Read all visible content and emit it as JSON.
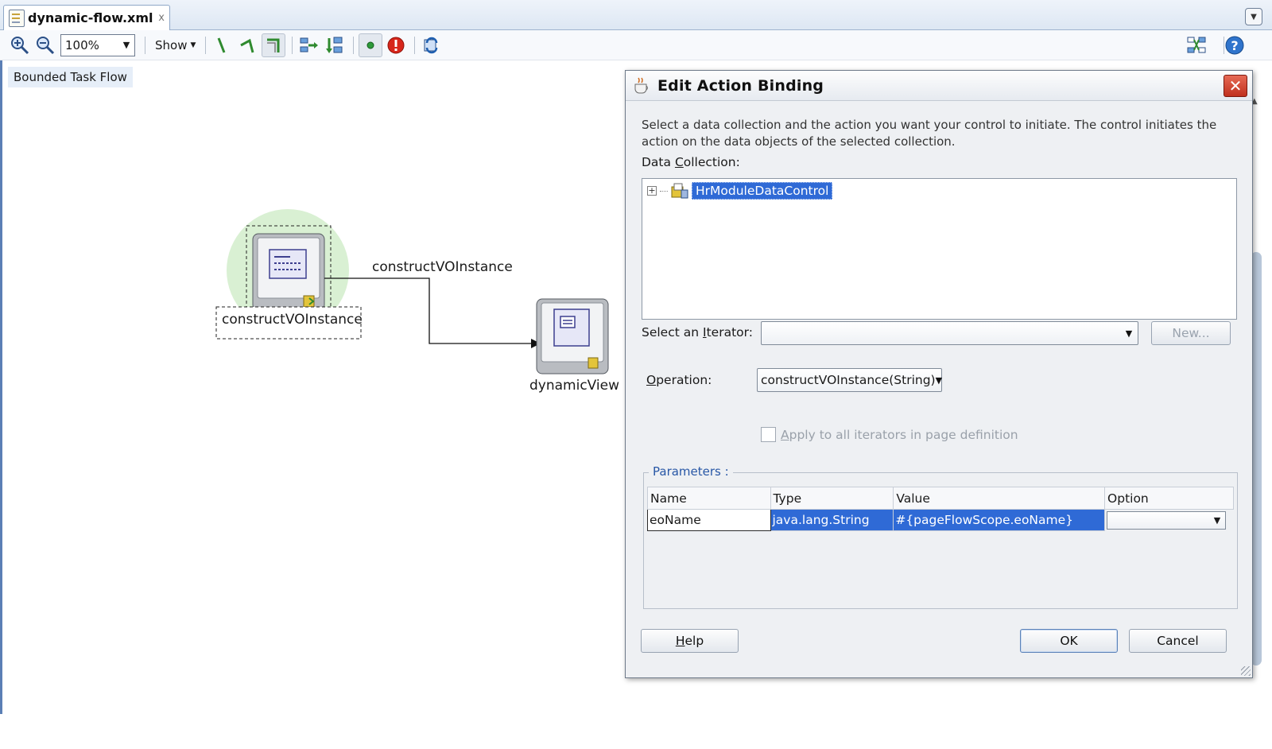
{
  "editor": {
    "tab_title": "dynamic-flow.xml",
    "tab_close": "x"
  },
  "toolbar": {
    "zoom_value": "100%",
    "show_label": "Show"
  },
  "canvas": {
    "label": "Bounded Task Flow",
    "nodes": [
      {
        "caption": "constructVOInstance"
      },
      {
        "caption": "dynamicView"
      }
    ],
    "edge_label": "constructVOInstance"
  },
  "dialog": {
    "title": "Edit Action Binding",
    "close_glyph": "✕",
    "description": "Select a data collection and the action you want your control to initiate. The control initiates the action on the data objects of the selected collection.",
    "data_collection_label_pre": "Data ",
    "data_collection_label_key": "C",
    "data_collection_label_post": "ollection:",
    "tree_expander": "+",
    "tree_root": "HrModuleDataControl",
    "iterator_label_pre": "Select an ",
    "iterator_label_key": "I",
    "iterator_label_post": "terator:",
    "iterator_value": "",
    "new_button": "New...",
    "operation_label_pre": "",
    "operation_label_key": "O",
    "operation_label_post": "peration:",
    "operation_value": "constructVOInstance(String)",
    "apply_all_label_pre": "",
    "apply_all_label_key": "A",
    "apply_all_label_post": "pply to all iterators in page definition",
    "params_legend": "Parameters :",
    "params_columns": [
      "Name",
      "Type",
      "Value",
      "Option"
    ],
    "params_columns_key": {
      "value": "V"
    },
    "params_rows": [
      {
        "name": "eoName",
        "type": "java.lang.String",
        "value": "#{pageFlowScope.eoName}",
        "option": ""
      }
    ],
    "help_button_key": "H",
    "help_button_rest": "elp",
    "ok_button": "OK",
    "cancel_button": "Cancel"
  }
}
